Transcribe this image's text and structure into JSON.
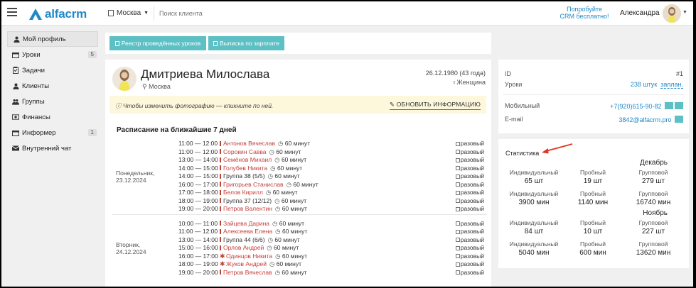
{
  "topbar": {
    "brand": "alfacrm",
    "city": "Москва",
    "search_placeholder": "Поиск клиента",
    "promo_line1": "Попробуйте",
    "promo_line2": "CRM бесплатно!",
    "user_name": "Александра"
  },
  "sidebar": {
    "items": [
      {
        "label": "Мой профиль",
        "icon": "user-icon",
        "badge": ""
      },
      {
        "label": "Уроки",
        "icon": "calendar-icon",
        "badge": "5"
      },
      {
        "label": "Задачи",
        "icon": "clipboard-icon",
        "badge": ""
      },
      {
        "label": "Клиенты",
        "icon": "user-icon",
        "badge": ""
      },
      {
        "label": "Группы",
        "icon": "users-icon",
        "badge": ""
      },
      {
        "label": "Финансы",
        "icon": "money-icon",
        "badge": ""
      },
      {
        "label": "Информер",
        "icon": "calendar-icon",
        "badge": "1"
      },
      {
        "label": "Внутренний чат",
        "icon": "envelope-icon",
        "badge": ""
      }
    ]
  },
  "toolbar": {
    "btn_register": "Реестр проведённых уроков",
    "btn_salary": "Выписка по зарплате"
  },
  "profile": {
    "name": "Дмитриева Милослава",
    "city": "Москва",
    "dob": "26.12.1980 (43 года)",
    "gender": "Женщина",
    "notice": "Чтобы изменить фотографию — кликните по ней.",
    "update_btn": "ОБНОВИТЬ ИНФОРМАЦИЮ"
  },
  "schedule": {
    "title": "Расписание на ближайшие 7 дней",
    "checkbox_label": "разовый",
    "days": [
      {
        "name_line1": "Понедельник,",
        "name_line2": "23.12.2024",
        "lessons": [
          {
            "time": "11:00 — 12:00",
            "who": "Антонов Вячеслав",
            "dur": "60 минут",
            "group": false,
            "star": false
          },
          {
            "time": "11:00 — 12:00",
            "who": "Сорокин Савва",
            "dur": "60 минут",
            "group": false,
            "star": false
          },
          {
            "time": "13:00 — 14:00",
            "who": "Семёнов Михаил",
            "dur": "60 минут",
            "group": false,
            "star": false
          },
          {
            "time": "14:00 — 15:00",
            "who": "Голубев Никита",
            "dur": "60 минут",
            "group": false,
            "star": false
          },
          {
            "time": "14:00 — 15:00",
            "who": "Группа 38 (5/5)",
            "dur": "60 минут",
            "group": true,
            "star": false
          },
          {
            "time": "16:00 — 17:00",
            "who": "Григорьев Станислав",
            "dur": "60 минут",
            "group": false,
            "star": false
          },
          {
            "time": "17:00 — 18:00",
            "who": "Белов Кирилл",
            "dur": "60 минут",
            "group": false,
            "star": false
          },
          {
            "time": "18:00 — 19:00",
            "who": "Группа 37 (12/12)",
            "dur": "60 минут",
            "group": true,
            "star": false
          },
          {
            "time": "19:00 — 20:00",
            "who": "Петров Валентин",
            "dur": "60 минут",
            "group": false,
            "star": false
          }
        ]
      },
      {
        "name_line1": "Вторник,",
        "name_line2": "24.12.2024",
        "lessons": [
          {
            "time": "10:00 — 11:00",
            "who": "Зайцева Дарина",
            "dur": "60 минут",
            "group": false,
            "star": false
          },
          {
            "time": "11:00 — 12:00",
            "who": "Алексеева Елена",
            "dur": "60 минут",
            "group": false,
            "star": false
          },
          {
            "time": "13:00 — 14:00",
            "who": "Группа 44 (6/6)",
            "dur": "60 минут",
            "group": true,
            "star": false
          },
          {
            "time": "15:00 — 16:00",
            "who": "Орлов Андрей",
            "dur": "60 минут",
            "group": false,
            "star": false
          },
          {
            "time": "16:00 — 17:00",
            "who": "Одинцов Никита",
            "dur": "60 минут",
            "group": false,
            "star": true
          },
          {
            "time": "18:00 — 19:00",
            "who": "Жуков Андрей",
            "dur": "60 минут",
            "group": false,
            "star": true
          },
          {
            "time": "19:00 — 20:00",
            "who": "Петров Вячеслав",
            "dur": "60 минут",
            "group": false,
            "star": false
          }
        ]
      }
    ]
  },
  "info": {
    "id_label": "ID",
    "id_value": "#1",
    "lessons_label": "Уроки",
    "lessons_count": "238 штук",
    "lessons_planned": "заплан.",
    "mobile_label": "Мобильный",
    "mobile_value": "+7(920)615-90-82",
    "email_label": "E-mail",
    "email_value": "3842@alfacrm.pro"
  },
  "stats": {
    "title": "Статистика",
    "months": [
      {
        "name": "Декабрь",
        "cells": [
          {
            "label": "Индивидуальный",
            "value": "65 шт"
          },
          {
            "label": "Пробный",
            "value": "19 шт"
          },
          {
            "label": "Групповой",
            "value": "279 шт"
          },
          {
            "label": "Индивидуальный",
            "value": "3900 мин"
          },
          {
            "label": "Пробный",
            "value": "1140 мин"
          },
          {
            "label": "Групповой",
            "value": "16740 мин"
          }
        ]
      },
      {
        "name": "Ноябрь",
        "cells": [
          {
            "label": "Индивидуальный",
            "value": "84 шт"
          },
          {
            "label": "Пробный",
            "value": "10 шт"
          },
          {
            "label": "Групповой",
            "value": "227 шт"
          },
          {
            "label": "Индивидуальный",
            "value": "5040 мин"
          },
          {
            "label": "Пробный",
            "value": "600 мин"
          },
          {
            "label": "Групповой",
            "value": "13620 мин"
          }
        ]
      }
    ]
  },
  "colors": {
    "brand": "#1e88c9",
    "accent_teal": "#5cc0c4",
    "name_red": "#c4403c",
    "arrow_red": "#e0341f",
    "notice_bg": "#fdf7dc"
  }
}
